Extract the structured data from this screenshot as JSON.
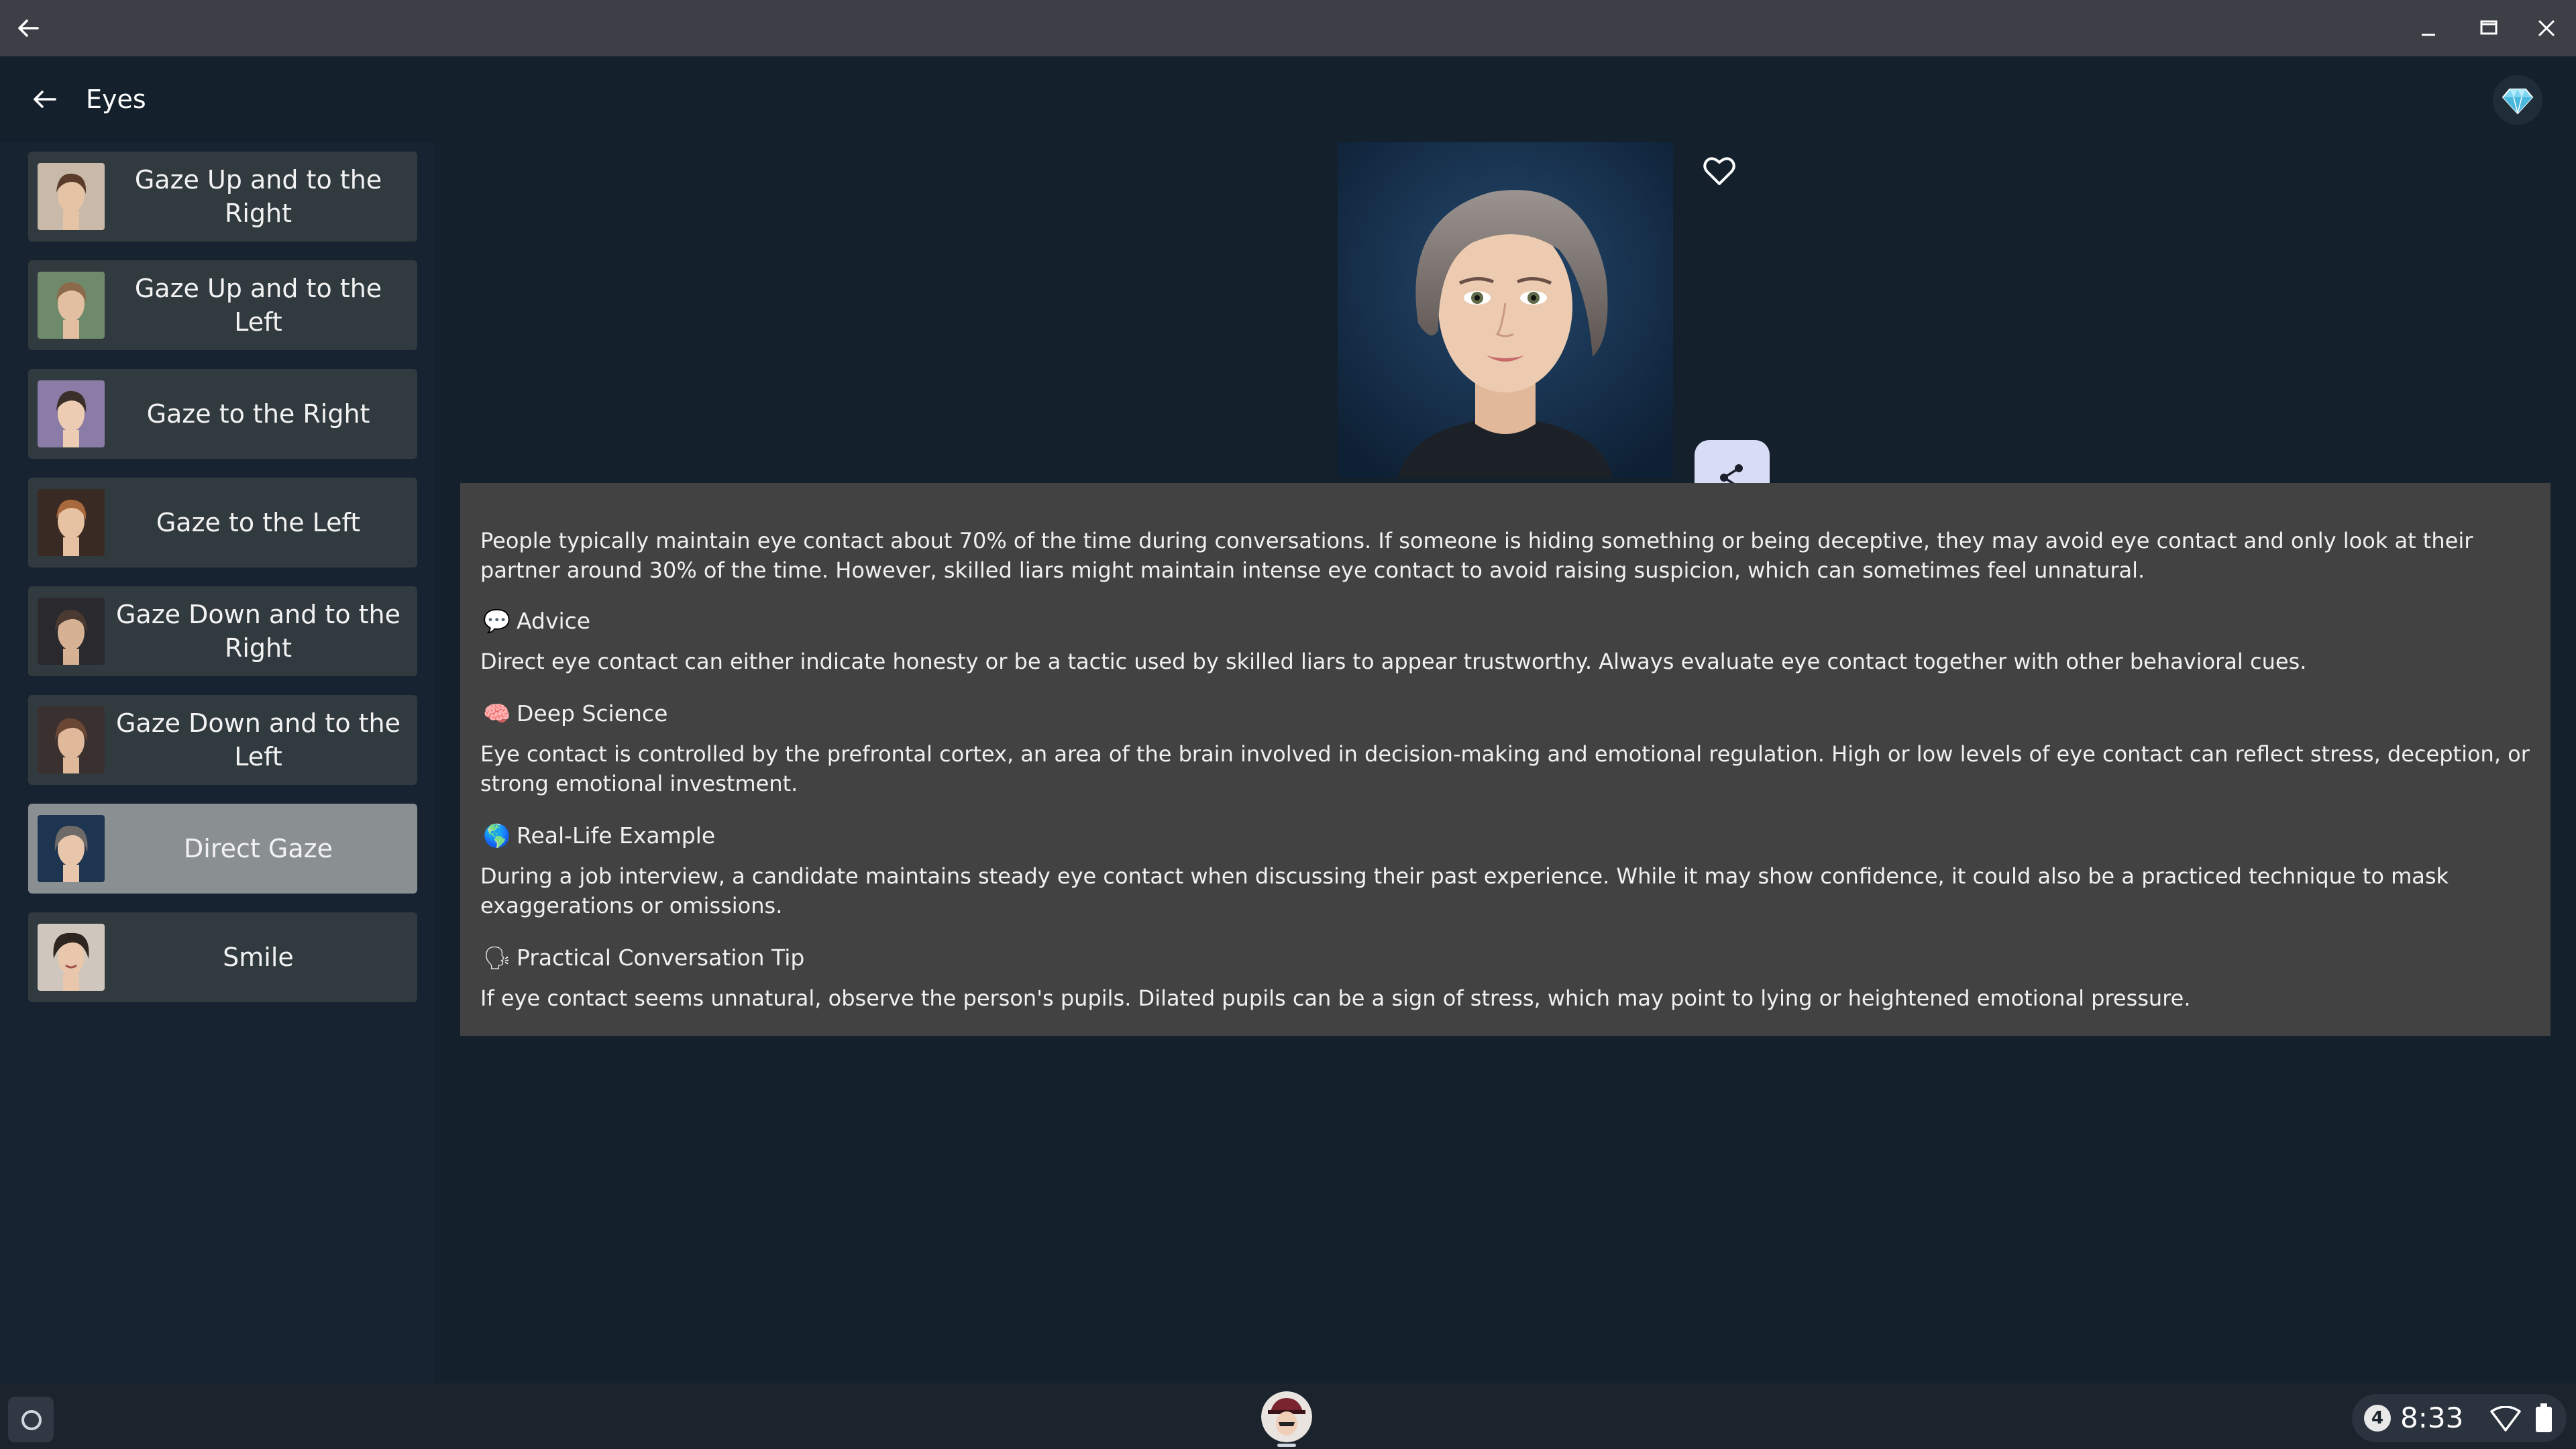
{
  "app": {
    "title": "Eyes"
  },
  "sidebar": {
    "items": [
      {
        "label": "Gaze Up and to the Right",
        "thumb": "woman-portrait-1",
        "active": false
      },
      {
        "label": "Gaze Up and to the Left",
        "thumb": "woman-portrait-2",
        "active": false
      },
      {
        "label": "Gaze to the Right",
        "thumb": "woman-portrait-3",
        "active": false
      },
      {
        "label": "Gaze to the Left",
        "thumb": "woman-portrait-4",
        "active": false
      },
      {
        "label": "Gaze Down and to the Right",
        "thumb": "woman-portrait-5",
        "active": false
      },
      {
        "label": "Gaze Down and to the Left",
        "thumb": "woman-portrait-6",
        "active": false
      },
      {
        "label": "Direct Gaze",
        "thumb": "woman-portrait-7",
        "active": true
      },
      {
        "label": "Smile",
        "thumb": "woman-portrait-8",
        "active": false
      }
    ]
  },
  "detail": {
    "intro": "People typically maintain eye contact about 70% of the time during conversations. If someone is hiding something or being deceptive, they may avoid eye contact and only look at their partner around 30% of the time. However, skilled liars might maintain intense eye contact to avoid raising suspicion, which can sometimes feel unnatural.",
    "sections": [
      {
        "icon": "💬",
        "title": "Advice",
        "body": "Direct eye contact can either indicate honesty or be a tactic used by skilled liars to appear trustworthy. Always evaluate eye contact together with other behavioral cues."
      },
      {
        "icon": "🧠",
        "title": "Deep Science",
        "body": "Eye contact is controlled by the prefrontal cortex, an area of the brain involved in decision-making and emotional regulation. High or low levels of eye contact can reflect stress, deception, or strong emotional investment."
      },
      {
        "icon": "🌎",
        "title": "Real-Life Example",
        "body": "During a job interview, a candidate maintains steady eye contact when discussing their past experience. While it may show confidence, it could also be a practiced technique to mask exaggerations or omissions."
      },
      {
        "icon": "🗣",
        "title": "Practical Conversation Tip",
        "body": "If eye contact seems unnatural, observe the person's pupils. Dilated pupils can be a sign of stress, which may point to lying or heightened emotional pressure."
      }
    ]
  },
  "system": {
    "notification_count": "4",
    "time": "8:33"
  },
  "colors": {
    "background": "#14202b",
    "panel": "#424242",
    "sidebar_item": "#313a3e",
    "sidebar_item_active": "#8a8f92",
    "share_button": "#d9dcf5"
  }
}
